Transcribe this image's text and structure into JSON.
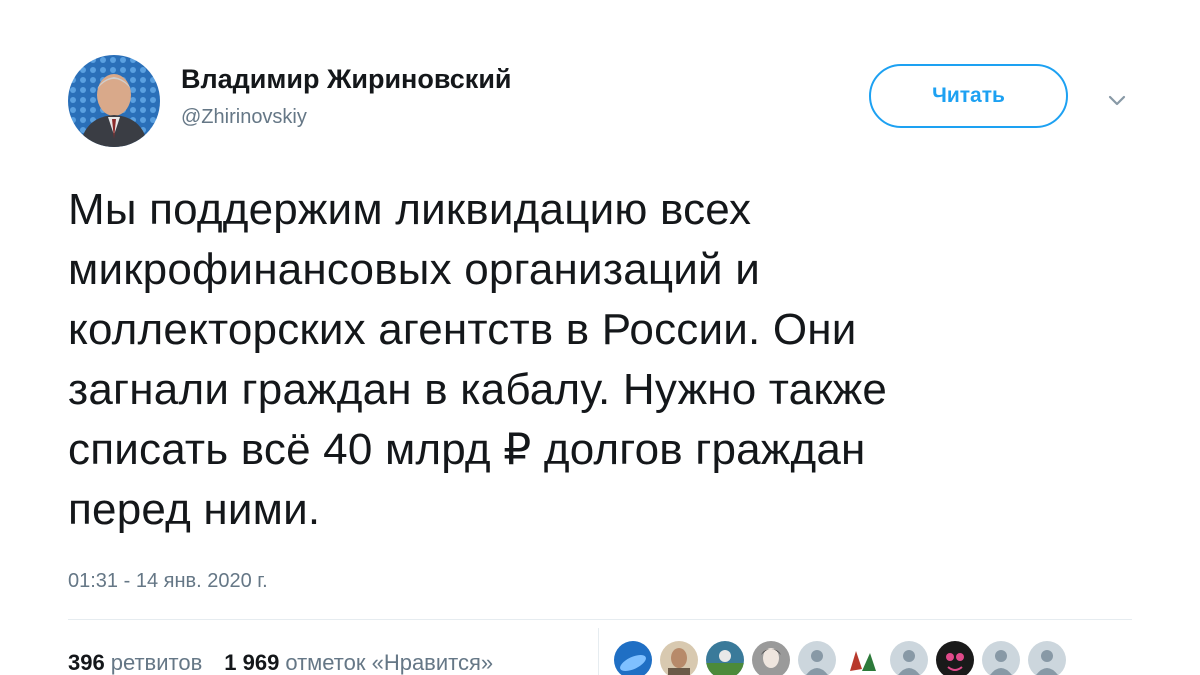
{
  "author": {
    "name": "Владимир Жириновский",
    "handle": "@Zhirinovskiy"
  },
  "follow_button": {
    "label": "Читать"
  },
  "menu": {
    "icon": "chevron-down-icon"
  },
  "tweet": {
    "text": "Мы поддержим ликвидацию всех\nмикрофинансовых организаций и\nколлекторских агентств в России. Они\nзагнали граждан в кабалу. Нужно также\nсписать всё 40 млрд ₽ долгов граждан\nперед ними.",
    "timestamp": "01:31 - 14 янв. 2020 г."
  },
  "stats": {
    "retweets_count": "396",
    "retweets_label": "ретвитов",
    "likes_count": "1 969",
    "likes_label": "отметок «Нравится»"
  },
  "colors": {
    "accent": "#1da1f2",
    "text": "#14171a",
    "secondary": "#657786",
    "divider": "#e6ecf0"
  }
}
